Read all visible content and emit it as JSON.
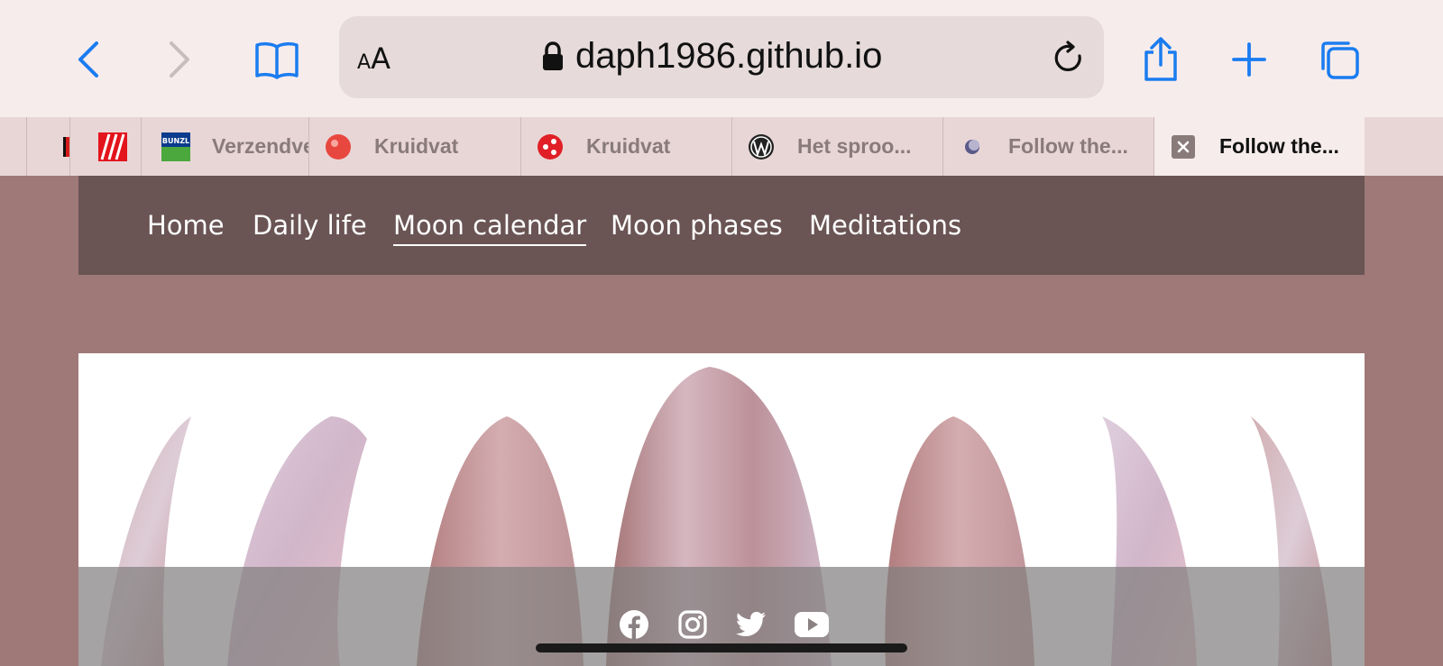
{
  "browser": {
    "address_bar": {
      "text_size_label_small": "A",
      "text_size_label_large": "A",
      "url": "daph1986.github.io"
    },
    "tabs": [
      {
        "title": ""
      },
      {
        "title": ""
      },
      {
        "title": "Verzendve"
      },
      {
        "title": "Kruidvat"
      },
      {
        "title": "Kruidvat"
      },
      {
        "title": "Het sproo..."
      },
      {
        "title": "Follow the..."
      },
      {
        "title": "Follow the..."
      }
    ],
    "favicon_bunzl_text": "BUNZL",
    "accent_color": "#1a7cf0"
  },
  "site": {
    "nav": {
      "items": [
        {
          "label": "Home"
        },
        {
          "label": "Daily life"
        },
        {
          "label": "Moon calendar"
        },
        {
          "label": "Moon phases"
        },
        {
          "label": "Meditations"
        }
      ],
      "current": "Moon calendar",
      "background": "#6a5454"
    },
    "page_background": "#9e7977",
    "hero": {
      "description": "watercolor moon phases"
    },
    "social_icons": [
      "facebook-icon",
      "instagram-icon",
      "twitter-icon",
      "youtube-icon"
    ]
  }
}
